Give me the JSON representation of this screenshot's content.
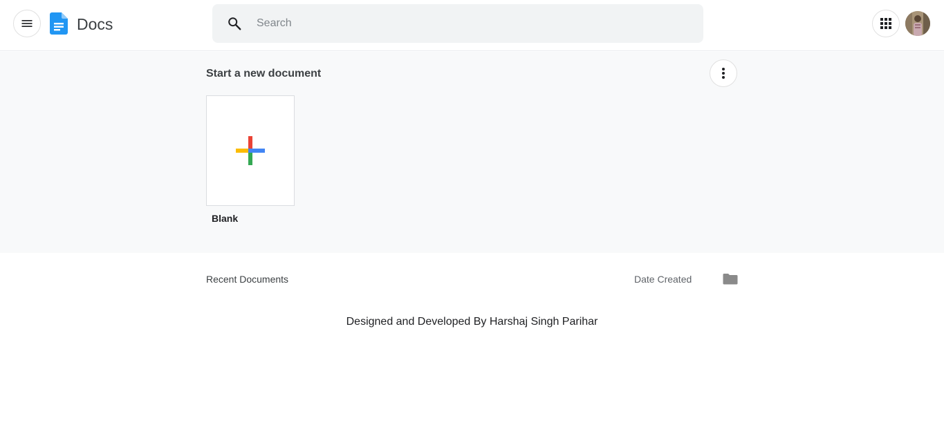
{
  "header": {
    "app_title": "Docs",
    "search": {
      "placeholder": "Search",
      "value": ""
    },
    "icons": {
      "menu": "hamburger-menu-icon",
      "logo": "docs-logo-icon",
      "search": "search-icon",
      "apps": "apps-grid-icon",
      "avatar": "user-avatar"
    }
  },
  "templates": {
    "title": "Start a new document",
    "more_icon": "more-vert-icon",
    "items": [
      {
        "label": "Blank",
        "icon": "plus-icon"
      }
    ]
  },
  "recent": {
    "title": "Recent Documents",
    "sort_label": "Date Created",
    "folder_icon": "folder-icon"
  },
  "footer": {
    "credit": "Designed and Developed By Harshaj Singh Parihar"
  },
  "colors": {
    "google_blue": "#4285F4",
    "google_red": "#EA4335",
    "google_yellow": "#FBBC04",
    "google_green": "#34A853",
    "docs_blue": "#2196F3",
    "templates_bg": "#f8f9fa"
  }
}
